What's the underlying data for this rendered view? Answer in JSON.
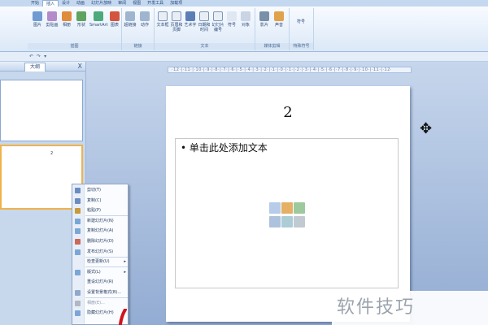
{
  "ribbon": {
    "tabs": [
      "开始",
      "插入",
      "设计",
      "动画",
      "幻灯片放映",
      "审阅",
      "视图",
      "开发工具",
      "加载项"
    ],
    "active_tab": "插入",
    "groups": [
      {
        "label": "插图",
        "buttons": [
          "图片",
          "剪贴画",
          "相册",
          "形状",
          "SmartArt",
          "图表"
        ]
      },
      {
        "label": "链接",
        "buttons": [
          "超链接",
          "动作"
        ]
      },
      {
        "label": "文本",
        "buttons": [
          "文本框",
          "页眉和页脚",
          "艺术字",
          "日期和时间",
          "幻灯片编号",
          "符号",
          "对象"
        ]
      },
      {
        "label": "媒体剪辑",
        "buttons": [
          "影片",
          "声音"
        ]
      },
      {
        "label": "特殊符号",
        "buttons": [
          "符号"
        ]
      }
    ]
  },
  "left_pane": {
    "tab_label": "大纲",
    "close": "X",
    "slide2_number": "2"
  },
  "slide": {
    "title": "2",
    "placeholder_text": "• 单击此处添加文本"
  },
  "ruler_text": "·12·|·11·|·10·|·9·|·8·|·7·|·6·|·5·|·4·|·3·|·2·|·1·|·0·|·1·|·2·|·3·|·4·|·5·|·6·|·7·|·8·|·9·|·10·|·11·|·12·",
  "context_menu": {
    "items": [
      {
        "label": "剪切(T)",
        "icon": "cut-icon",
        "submenu": false,
        "disabled": false
      },
      {
        "label": "复制(C)",
        "icon": "copy-icon",
        "submenu": false,
        "disabled": false
      },
      {
        "label": "粘贴(P)",
        "icon": "paste-icon",
        "submenu": false,
        "disabled": false
      },
      {
        "label": "新建幻灯片(N)",
        "icon": "new-slide-icon",
        "submenu": false,
        "disabled": false
      },
      {
        "label": "复制幻灯片(A)",
        "icon": "duplicate-slide-icon",
        "submenu": false,
        "disabled": false
      },
      {
        "label": "删除幻灯片(D)",
        "icon": "delete-slide-icon",
        "submenu": false,
        "disabled": false
      },
      {
        "label": "发布幻灯片(S)",
        "icon": "publish-icon",
        "submenu": false,
        "disabled": false
      },
      {
        "label": "检查更新(U)",
        "icon": "",
        "submenu": true,
        "disabled": false
      },
      {
        "label": "版式(L)",
        "icon": "layout-icon",
        "submenu": true,
        "disabled": false
      },
      {
        "label": "重设幻灯片(R)",
        "icon": "",
        "submenu": false,
        "disabled": false
      },
      {
        "label": "设置背景格式(B)...",
        "icon": "background-icon",
        "submenu": false,
        "disabled": false
      },
      {
        "label": "相册(E)...",
        "icon": "album-icon",
        "submenu": false,
        "disabled": true
      },
      {
        "label": "隐藏幻灯片(H)",
        "icon": "hide-slide-icon",
        "submenu": false,
        "disabled": false
      }
    ]
  },
  "watermark": "软件技巧",
  "colors": {
    "accent": "#2b4a78",
    "workspace": "#a9bfe0"
  }
}
